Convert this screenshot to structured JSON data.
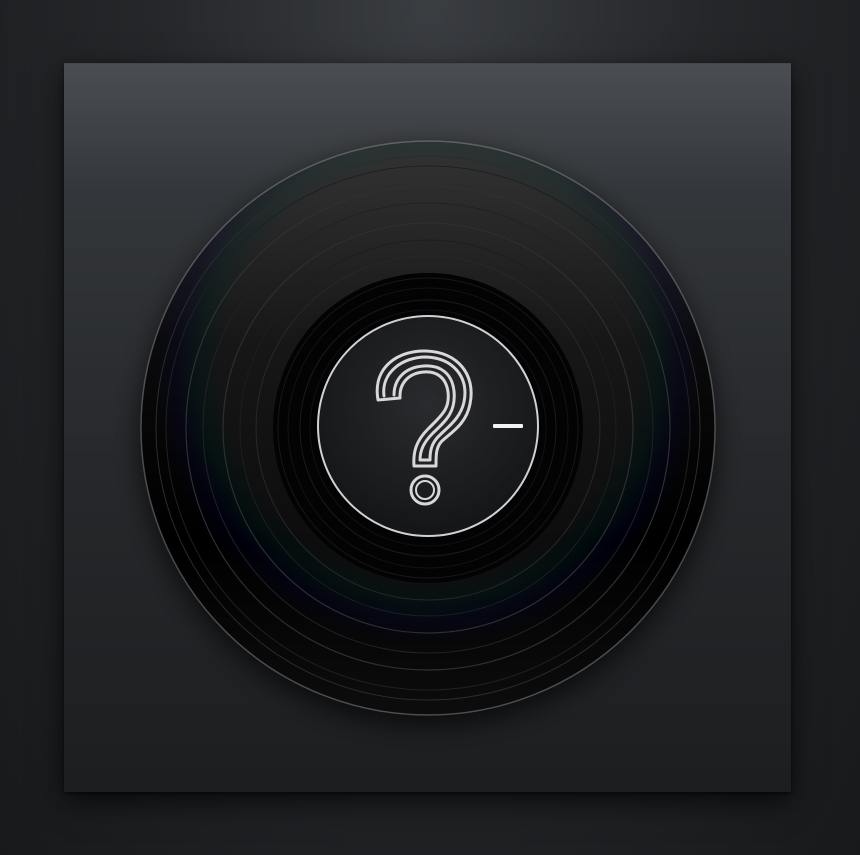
{
  "artwork": {
    "subject": "vinyl-record-placeholder",
    "center_icon": "question-mark-icon",
    "colors": {
      "background": "#1d1f22",
      "sleeve": "#2b2d30",
      "record": "#050607",
      "label": "#1a1b1d",
      "outline": "#d8d8d8"
    }
  }
}
